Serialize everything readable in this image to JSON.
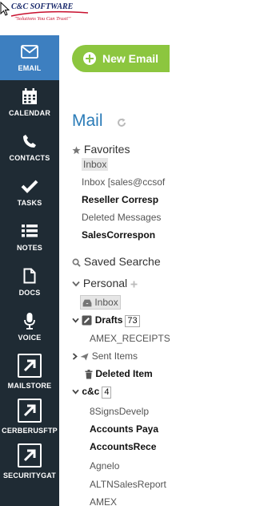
{
  "brand": {
    "name": "C&C SOFTWARE",
    "tagline": "\"Solutions You Can Trust!\""
  },
  "sidebar": {
    "items": [
      {
        "label": "EMAIL",
        "icon": "envelope-icon",
        "active": true
      },
      {
        "label": "CALENDAR",
        "icon": "calendar-icon"
      },
      {
        "label": "CONTACTS",
        "icon": "phone-icon"
      },
      {
        "label": "TASKS",
        "icon": "checkmark-icon"
      },
      {
        "label": "NOTES",
        "icon": "list-icon"
      },
      {
        "label": "DOCS",
        "icon": "document-icon"
      },
      {
        "label": "VOICE",
        "icon": "microphone-icon"
      },
      {
        "label": "MAILSTORE",
        "icon": "external-link-icon"
      },
      {
        "label": "CERBERUSFTP",
        "icon": "external-link-icon"
      },
      {
        "label": "SECURITYGAT",
        "icon": "external-link-icon"
      }
    ]
  },
  "toolbar": {
    "new_email_label": "New Email"
  },
  "mail": {
    "title": "Mail",
    "favorites": {
      "label": "Favorites",
      "items": [
        "Inbox",
        "Inbox [sales@ccsof",
        "Reseller Corresp",
        "Deleted Messages",
        "SalesCorrespon"
      ]
    },
    "saved_searches_label": "Saved Searche",
    "personal": {
      "label": "Personal",
      "inbox": "Inbox",
      "drafts": {
        "label": "Drafts",
        "count": "73"
      },
      "amex_receipts": "AMEX_RECEIPTS",
      "sent_items": "Sent Items",
      "deleted_items": "Deleted Item",
      "cc": {
        "label": "c&c",
        "count": "4"
      },
      "folders": [
        "8SignsDevelp",
        "Accounts Paya",
        "AccountsRece",
        "Agnelo",
        "ALTNSalesReport",
        "AMEX"
      ]
    }
  },
  "colors": {
    "sidebar_bg": "#1f2b34",
    "sidebar_active": "#3d7fc0",
    "new_email_green": "#8cc63f",
    "mail_title_blue": "#2b7cb8"
  }
}
